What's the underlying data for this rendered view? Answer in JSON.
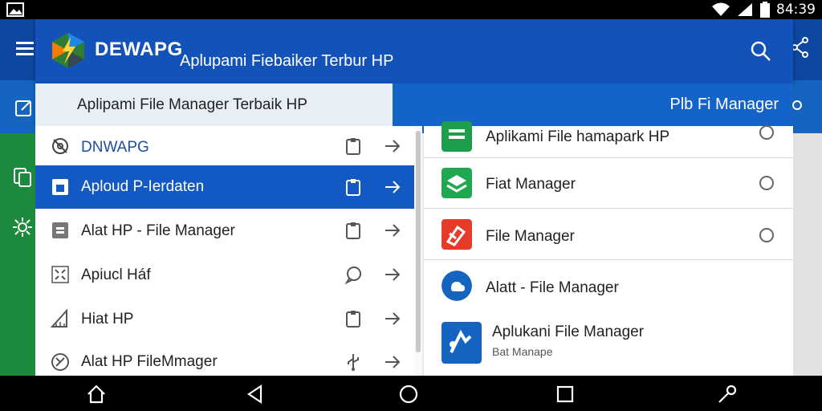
{
  "status_bar": {
    "time": "84:39"
  },
  "header": {
    "brand": "DEWAPG",
    "subtitle": "Aplupami Fiebaiker Terbur HP"
  },
  "banner": {
    "left_text": "Aplipami File Manager Terbaik HP",
    "right_text": "Plb Fi Manager"
  },
  "left_list": [
    {
      "label": "DNWAPG",
      "icon": "gear-off-icon",
      "mid_icon": "clipboard-icon"
    },
    {
      "label": "Aploud P-Ierdaten",
      "icon": "file-box-icon",
      "mid_icon": "clipboard-icon",
      "selected": true
    },
    {
      "label": "Alat HP - File Manager",
      "icon": "archive-icon",
      "mid_icon": "clipboard-icon"
    },
    {
      "label": "Apiucl Háf",
      "icon": "shrink-icon",
      "mid_icon": "chat-bubble-icon"
    },
    {
      "label": "Hiat HP",
      "icon": "ruler-icon",
      "mid_icon": "clipboard-icon"
    },
    {
      "label": "Alat HP FileMmager",
      "icon": "compass-icon",
      "mid_icon": "usb-icon"
    }
  ],
  "right_list": [
    {
      "label": "Aplikami File hamapark HP",
      "icon": "green-doc-icon",
      "color": "#1e9e4a"
    },
    {
      "label": "Fiat Manager",
      "icon": "green-layers-icon",
      "color": "#1fa84f"
    },
    {
      "label": "File Manager",
      "icon": "red-file-icon",
      "color": "#e53c2a"
    },
    {
      "label": "Alatt - File Manager",
      "icon": "blue-cloud-icon",
      "color": "#1565c0"
    },
    {
      "label": "Aplukani File Manager",
      "sublabel": "Bat Manape",
      "icon": "blue-app-icon",
      "color": "#1565c0"
    }
  ],
  "colors": {
    "primary": "#1352b8",
    "selected": "#1259c3",
    "accent_green": "#1b8a3c"
  }
}
